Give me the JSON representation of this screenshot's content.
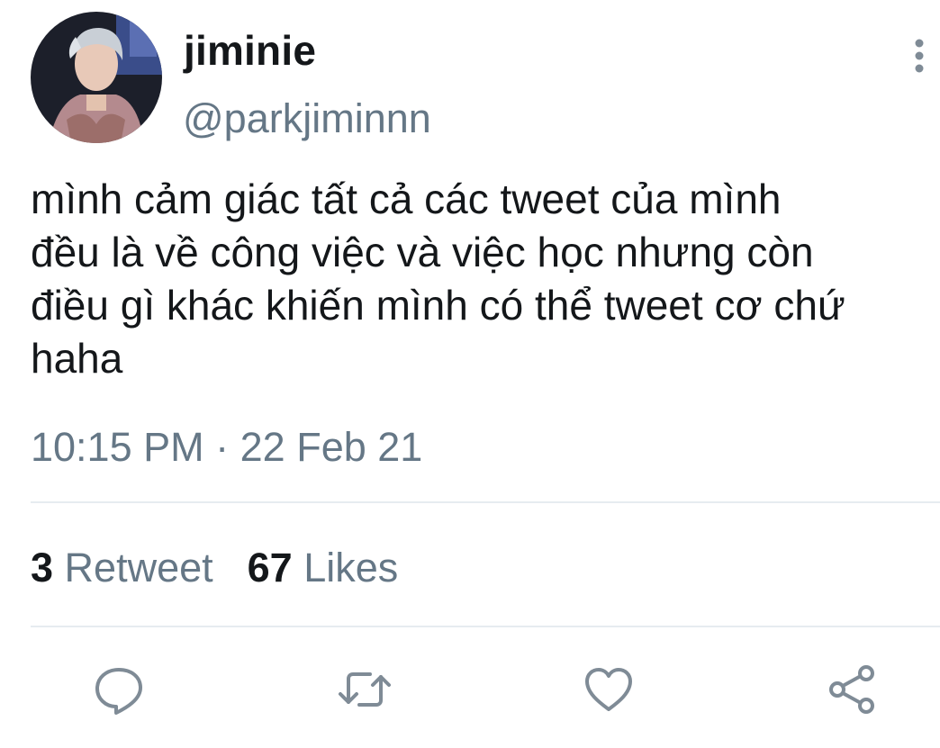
{
  "user": {
    "display_name": "jiminie",
    "handle": "@parkjiminnn",
    "avatar": "profile-photo"
  },
  "tweet": {
    "text": "mình cảm giác tất cả các tweet của mình\nđều là về công việc và việc học nhưng còn\nđiều gì khác khiến mình có thể tweet cơ chứ\nhaha",
    "time": "10:15 PM",
    "separator": "·",
    "date": "22 Feb 21"
  },
  "stats": {
    "retweet_count": "3",
    "retweet_label": "Retweet",
    "likes_count": "67",
    "likes_label": "Likes"
  },
  "actions": {
    "reply_icon": "reply-icon",
    "retweet_icon": "retweet-icon",
    "like_icon": "heart-icon",
    "share_icon": "share-icon"
  },
  "colors": {
    "text_primary": "#14171a",
    "text_secondary": "#657786",
    "divider": "#e6ecf0"
  }
}
